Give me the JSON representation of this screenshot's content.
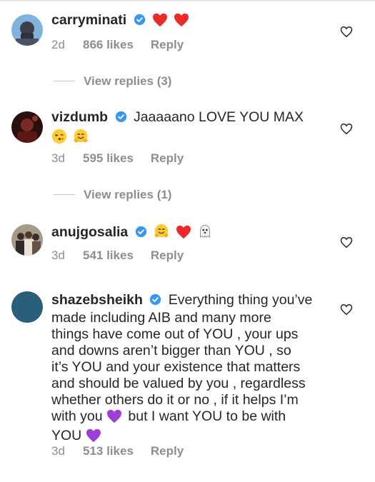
{
  "comments": [
    {
      "username": "carryminati",
      "text": "",
      "emojis": [
        "heart-emoji",
        "heart-emoji"
      ],
      "time": "2d",
      "likes": "866 likes",
      "reply": "Reply",
      "view_replies": "View replies (3)"
    },
    {
      "username": "vizdumb",
      "text": "Jaaaaano LOVE YOU MAX",
      "emojis": [
        "kissing-heart-emoji",
        "hugging-emoji"
      ],
      "time": "3d",
      "likes": "595 likes",
      "reply": "Reply",
      "view_replies": "View replies (1)"
    },
    {
      "username": "anujgosalia",
      "text": "",
      "emojis": [
        "hugging-emoji",
        "heart-emoji",
        "ghost-emoji"
      ],
      "time": "3d",
      "likes": "541 likes",
      "reply": "Reply"
    },
    {
      "username": "shazebsheikh",
      "lines": [
        "Everything thing you’ve",
        "made including AIB and many more",
        "things have come out of YOU , your ups",
        "and downs aren’t bigger than YOU , so",
        "it’s YOU and your existence that matters",
        "and should be valued by you , regardless",
        "whether others do it or no , if it helps I’m",
        "with you",
        "but I want YOU to be with",
        "YOU"
      ],
      "emojis": [
        "purple-heart-emoji",
        "purple-heart-emoji"
      ],
      "time": "3d",
      "likes": "513 likes",
      "reply": "Reply"
    }
  ],
  "colors": {
    "text": "#262626",
    "secondary": "#8e8e8e",
    "verified": "#3897f0",
    "heart_red": "#ed2a2a",
    "purple_heart": "#9b3fd6"
  }
}
